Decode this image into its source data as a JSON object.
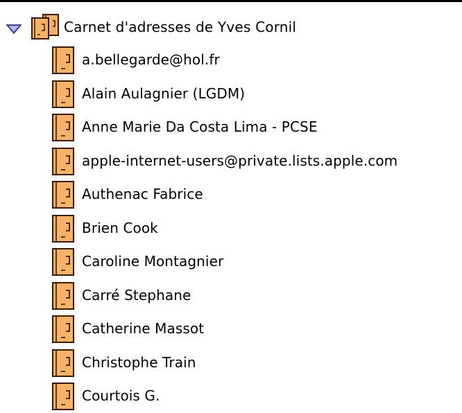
{
  "address_book": {
    "title": "Carnet d'adresses de Yves Cornil",
    "expanded": true,
    "icons": {
      "disclosure": "disclosure-triangle-down-icon",
      "group": "address-book-group-icon",
      "card": "address-card-icon"
    },
    "colors": {
      "icon_fill": "#F5B36A",
      "icon_stroke": "#3A1A00",
      "disclosure_fill": "#8C8CD8"
    },
    "contacts": [
      {
        "label": "a.bellegarde@hol.fr"
      },
      {
        "label": "Alain Aulagnier  (LGDM)"
      },
      {
        "label": "Anne Marie Da Costa Lima  - PCSE"
      },
      {
        "label": "apple-internet-users@private.lists.apple.com"
      },
      {
        "label": "Authenac Fabrice"
      },
      {
        "label": "Brien Cook"
      },
      {
        "label": "Caroline Montagnier"
      },
      {
        "label": "Carré Stephane"
      },
      {
        "label": "Catherine Massot"
      },
      {
        "label": "Christophe Train"
      },
      {
        "label": "Courtois G."
      }
    ]
  }
}
